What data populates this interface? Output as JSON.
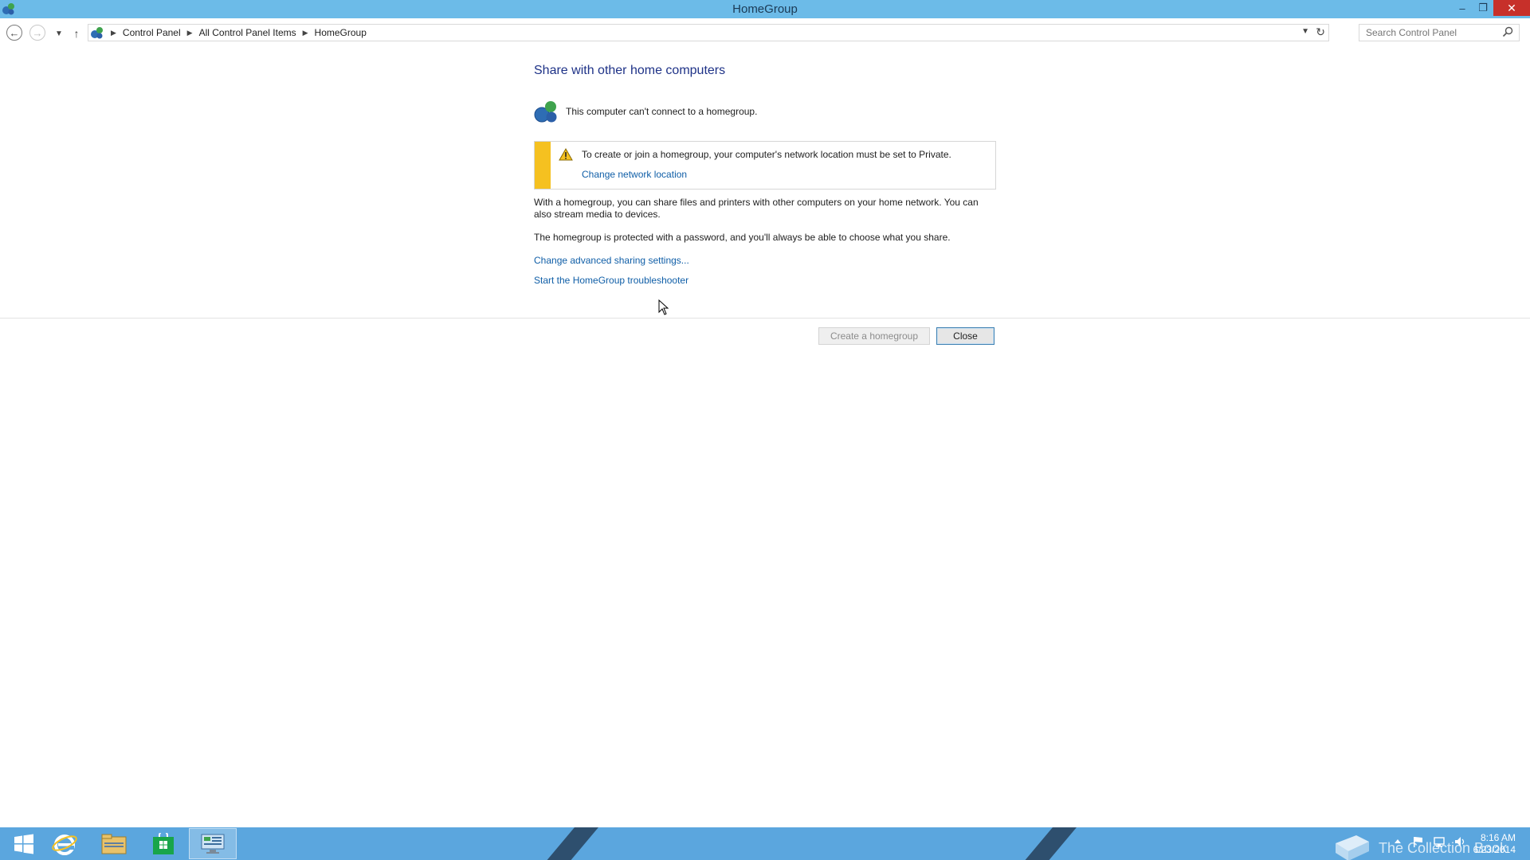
{
  "window": {
    "title": "HomeGroup",
    "minimize": "–",
    "maximize": "❐",
    "close": "✕"
  },
  "nav": {
    "back": "←",
    "forward": "→",
    "recent": "▼",
    "up": "↑",
    "breadcrumbs": [
      "Control Panel",
      "All Control Panel Items",
      "HomeGroup"
    ],
    "dropdown": "▼",
    "refresh": "↻"
  },
  "search": {
    "placeholder": "Search Control Panel"
  },
  "main": {
    "heading": "Share with other home computers",
    "status_text": "This computer can't connect to a homegroup.",
    "warning": {
      "message": "To create or join a homegroup, your computer's network location must be set to Private.",
      "link": "Change network location"
    },
    "paragraph1": "With a homegroup, you can share files and printers with other computers on your home network. You can also stream media to devices.",
    "paragraph2": "The homegroup is protected with a password, and you'll always be able to choose what you share.",
    "link_advanced": "Change advanced sharing settings...",
    "link_troubleshooter": "Start the HomeGroup troubleshooter",
    "create_button": "Create a homegroup",
    "close_button": "Close"
  },
  "taskbar": {
    "watermark": "The Collection Book",
    "time": "8:16 AM",
    "date": "6/23/2014"
  },
  "colors": {
    "titlebar": "#6cbbe8",
    "taskbar": "#5ba6de",
    "link": "#0f5ea7",
    "heading": "#1e3287",
    "warning_stripe": "#f5c120",
    "close_button": "#c7302a"
  }
}
